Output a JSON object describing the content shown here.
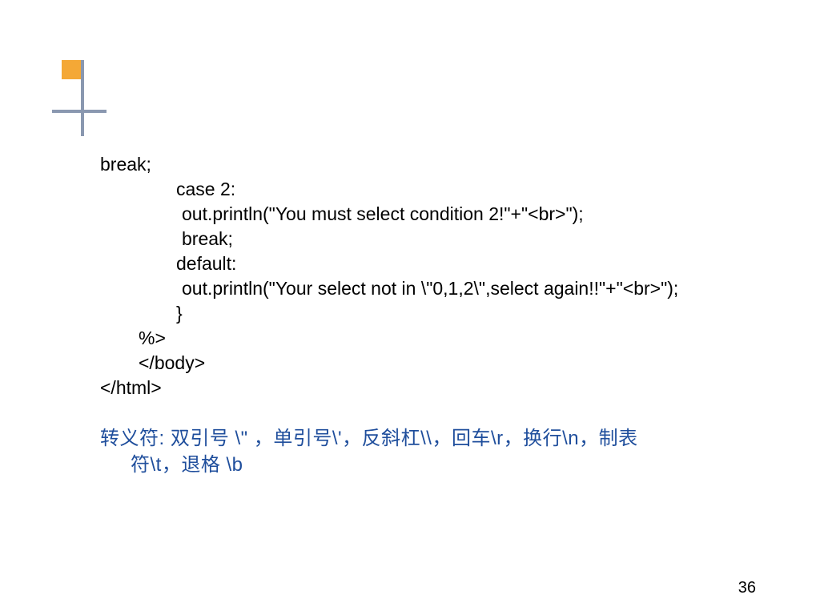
{
  "code": {
    "line1": "break;",
    "line2": "case 2:",
    "line3": "out.println(\"You must select condition 2!\"+\"<br>\");",
    "line4": "break;",
    "line5": "default:",
    "line6": "out.println(\"Your select not in \\\"0,1,2\\\",select again!!\"+\"<br>\");",
    "line7": "}",
    "line8": "%>",
    "line9": "</body>",
    "line10": "</html>"
  },
  "note": {
    "line1": "转义符: 双引号 \\\" ，单引号\\'，反斜杠\\\\，回车\\r，换行\\n，制表",
    "line2": "符\\t，退格   \\b"
  },
  "pageNumber": "36"
}
